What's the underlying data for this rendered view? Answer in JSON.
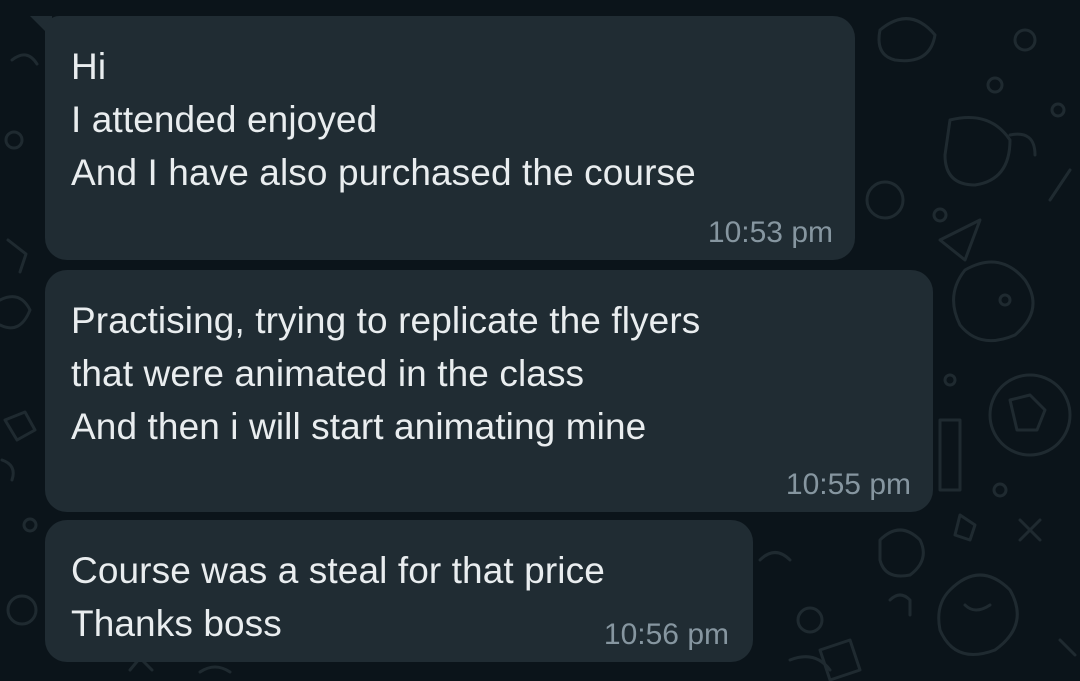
{
  "theme": {
    "background": "#0b141a",
    "bubble_incoming": "#202c33",
    "text_primary": "#e9edef",
    "text_timestamp": "#8696a0",
    "doodle_color": "#1c262c"
  },
  "messages": [
    {
      "direction": "incoming",
      "text": "Hi\nI attended enjoyed\nAnd I have also purchased the course",
      "time": "10:53 pm"
    },
    {
      "direction": "incoming",
      "text": "Practising, trying to replicate the flyers\nthat were animated in the class\nAnd then i will start animating mine",
      "time": "10:55 pm"
    },
    {
      "direction": "incoming",
      "text": "Course was a steal for that price\nThanks boss",
      "time": "10:56 pm"
    }
  ]
}
